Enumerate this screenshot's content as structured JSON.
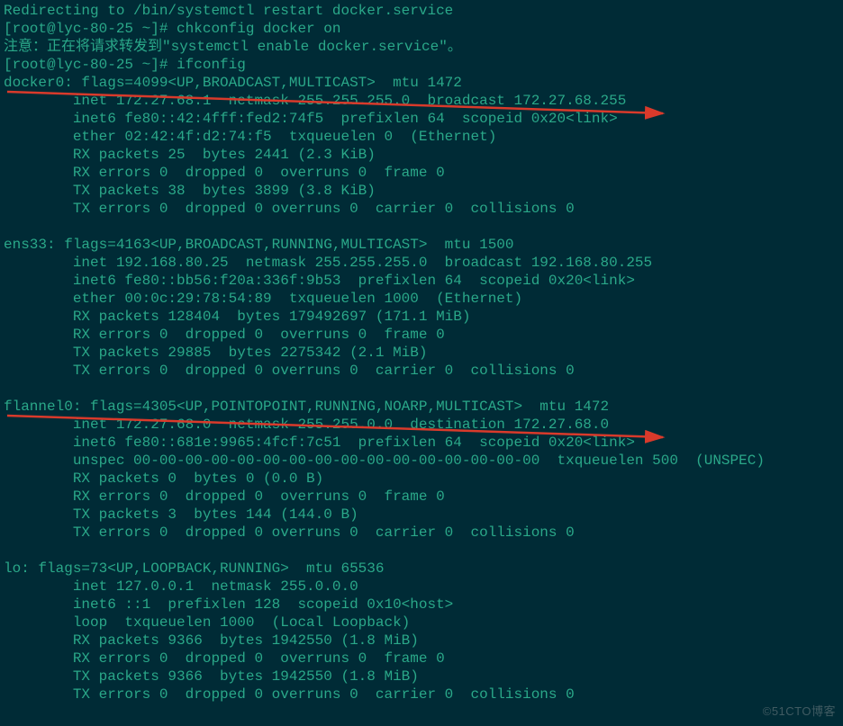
{
  "lines": [
    "Redirecting to /bin/systemctl restart docker.service",
    "[root@lyc-80-25 ~]# chkconfig docker on",
    "注意：正在将请求转发到\"systemctl enable docker.service\"。",
    "[root@lyc-80-25 ~]# ifconfig",
    "docker0: flags=4099<UP,BROADCAST,MULTICAST>  mtu 1472",
    "        inet 172.27.68.1  netmask 255.255.255.0  broadcast 172.27.68.255",
    "        inet6 fe80::42:4fff:fed2:74f5  prefixlen 64  scopeid 0x20<link>",
    "        ether 02:42:4f:d2:74:f5  txqueuelen 0  (Ethernet)",
    "        RX packets 25  bytes 2441 (2.3 KiB)",
    "        RX errors 0  dropped 0  overruns 0  frame 0",
    "        TX packets 38  bytes 3899 (3.8 KiB)",
    "        TX errors 0  dropped 0 overruns 0  carrier 0  collisions 0",
    "",
    "ens33: flags=4163<UP,BROADCAST,RUNNING,MULTICAST>  mtu 1500",
    "        inet 192.168.80.25  netmask 255.255.255.0  broadcast 192.168.80.255",
    "        inet6 fe80::bb56:f20a:336f:9b53  prefixlen 64  scopeid 0x20<link>",
    "        ether 00:0c:29:78:54:89  txqueuelen 1000  (Ethernet)",
    "        RX packets 128404  bytes 179492697 (171.1 MiB)",
    "        RX errors 0  dropped 0  overruns 0  frame 0",
    "        TX packets 29885  bytes 2275342 (2.1 MiB)",
    "        TX errors 0  dropped 0 overruns 0  carrier 0  collisions 0",
    "",
    "flannel0: flags=4305<UP,POINTOPOINT,RUNNING,NOARP,MULTICAST>  mtu 1472",
    "        inet 172.27.68.0  netmask 255.255.0.0  destination 172.27.68.0",
    "        inet6 fe80::681e:9965:4fcf:7c51  prefixlen 64  scopeid 0x20<link>",
    "        unspec 00-00-00-00-00-00-00-00-00-00-00-00-00-00-00-00  txqueuelen 500  (UNSPEC)",
    "        RX packets 0  bytes 0 (0.0 B)",
    "        RX errors 0  dropped 0  overruns 0  frame 0",
    "        TX packets 3  bytes 144 (144.0 B)",
    "        TX errors 0  dropped 0 overruns 0  carrier 0  collisions 0",
    "",
    "lo: flags=73<UP,LOOPBACK,RUNNING>  mtu 65536",
    "        inet 127.0.0.1  netmask 255.0.0.0",
    "        inet6 ::1  prefixlen 128  scopeid 0x10<host>",
    "        loop  txqueuelen 1000  (Local Loopback)",
    "        RX packets 9366  bytes 1942550 (1.8 MiB)",
    "        RX errors 0  dropped 0  overruns 0  frame 0",
    "        TX packets 9366  bytes 1942550 (1.8 MiB)",
    "        TX errors 0  dropped 0 overruns 0  carrier 0  collisions 0",
    ""
  ],
  "watermark": "©51CTO博客"
}
